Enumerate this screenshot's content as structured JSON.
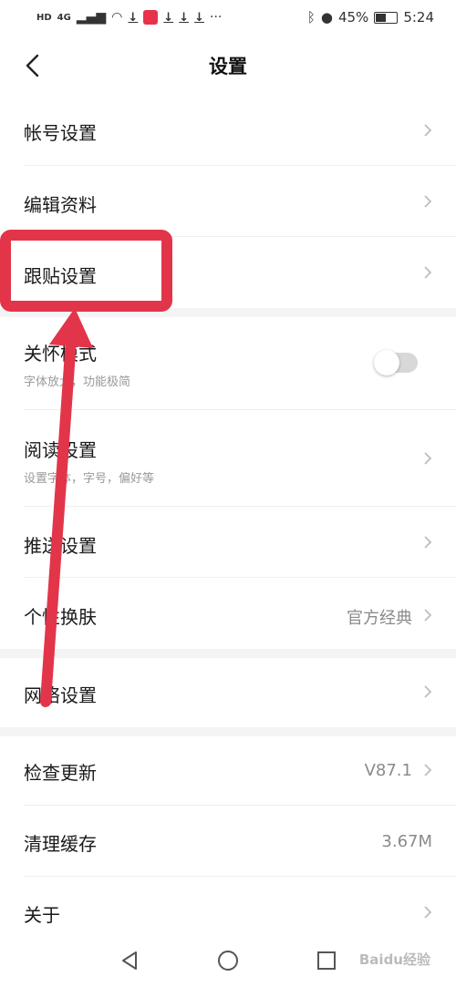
{
  "status_bar": {
    "left_hd": "HD",
    "left_signal": "4G",
    "left_more": "···",
    "battery_pct": "45%",
    "time": "5:24"
  },
  "header": {
    "title": "设置"
  },
  "rows": {
    "account": {
      "label": "帐号设置"
    },
    "profile": {
      "label": "编辑资料"
    },
    "follow": {
      "label": "跟贴设置"
    },
    "care": {
      "label": "关怀模式",
      "sub": "字体放大，功能极简",
      "enabled": false
    },
    "reading": {
      "label": "阅读设置",
      "sub": "设置字体，字号，偏好等"
    },
    "push": {
      "label": "推送设置"
    },
    "skin": {
      "label": "个性换肤",
      "value": "官方经典"
    },
    "network": {
      "label": "网络设置"
    },
    "update": {
      "label": "检查更新",
      "value": "V87.1"
    },
    "cache": {
      "label": "清理缓存",
      "value": "3.67M"
    },
    "about": {
      "label": "关于"
    }
  },
  "watermark": {
    "text": "Baidu经验"
  },
  "colors": {
    "annotation": "#e3354a",
    "divider": "#efefef",
    "section_gap": "#f4f4f4"
  }
}
